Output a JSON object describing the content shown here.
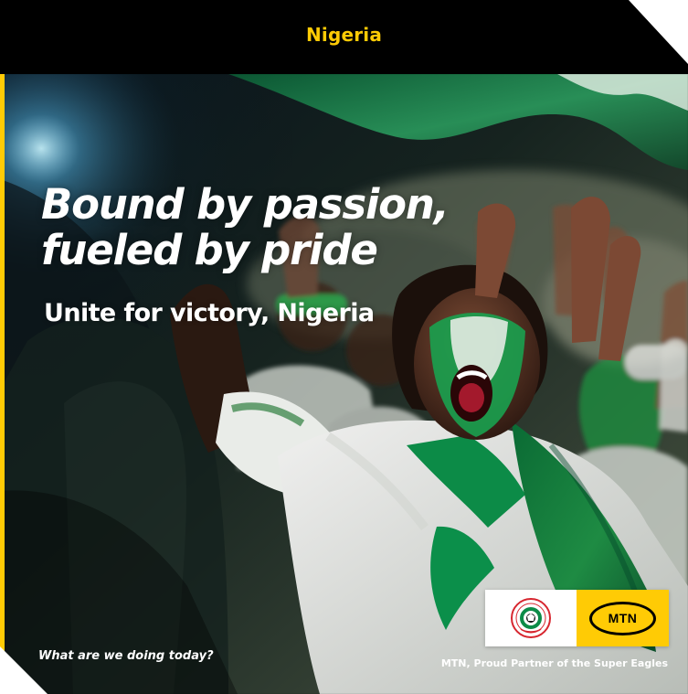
{
  "header": {
    "title": "Nigeria"
  },
  "campaign": {
    "headline_line_1": "Bound by passion,",
    "headline_line_2": "fueled by pride",
    "subheadline": "Unite for victory, Nigeria",
    "tagline": "What are we doing today?",
    "partner_text": "MTN, Proud Partner of the Super Eagles"
  },
  "logos": {
    "mtn_label": "MTN",
    "nff_badge_text": "NIGERIA FOOTBALL FEDERATION",
    "nff_year": "1945"
  },
  "colors": {
    "brand_yellow": "#ffcb05",
    "header_black": "#000000",
    "nigeria_green": "#00894b",
    "headline_white": "#ffffff"
  },
  "icons": {
    "federation_logo": "football-federation-crest",
    "mtn_logo": "mtn-oval-logo"
  }
}
